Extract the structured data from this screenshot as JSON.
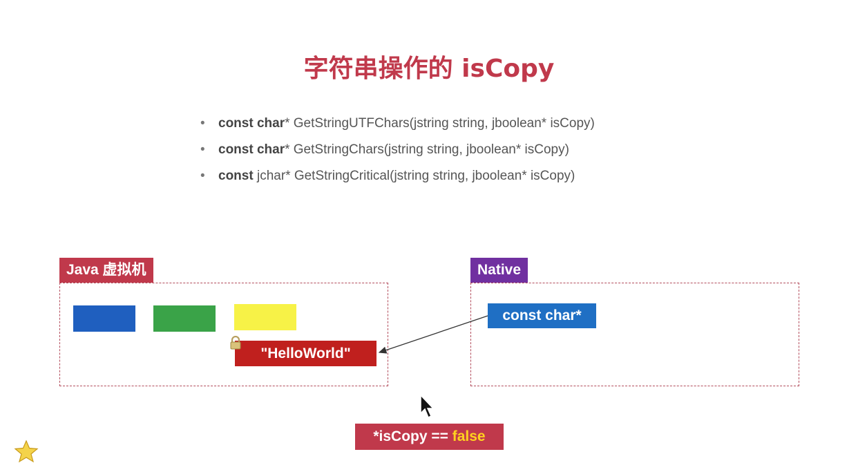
{
  "title": "字符串操作的 isCopy",
  "bullets": [
    {
      "bold": "const char",
      "rest": "* GetStringUTFChars(jstring string, jboolean* isCopy)"
    },
    {
      "bold": "const char",
      "rest": "* GetStringChars(jstring string, jboolean* isCopy)"
    },
    {
      "bold": "const",
      "rest": " jchar* GetStringCritical(jstring string, jboolean* isCopy)"
    }
  ],
  "jvm": {
    "label": "Java 虚拟机",
    "blocks": [
      "#1f5fbf",
      "#3aa348",
      "#f7f247"
    ],
    "string_value": "\"HelloWorld\""
  },
  "native": {
    "label": "Native",
    "pointer": "const char*"
  },
  "footer": {
    "lhs": "*isCopy == ",
    "value": "false"
  },
  "colors": {
    "title": "#c0394b",
    "jvm_label": "#c0394b",
    "native_label": "#7030a0",
    "string_box": "#c0201e",
    "pointer_box": "#1f6fc4",
    "footer_value": "#ffd21f"
  },
  "icons": [
    "lock-icon",
    "cursor-icon",
    "star-icon"
  ]
}
